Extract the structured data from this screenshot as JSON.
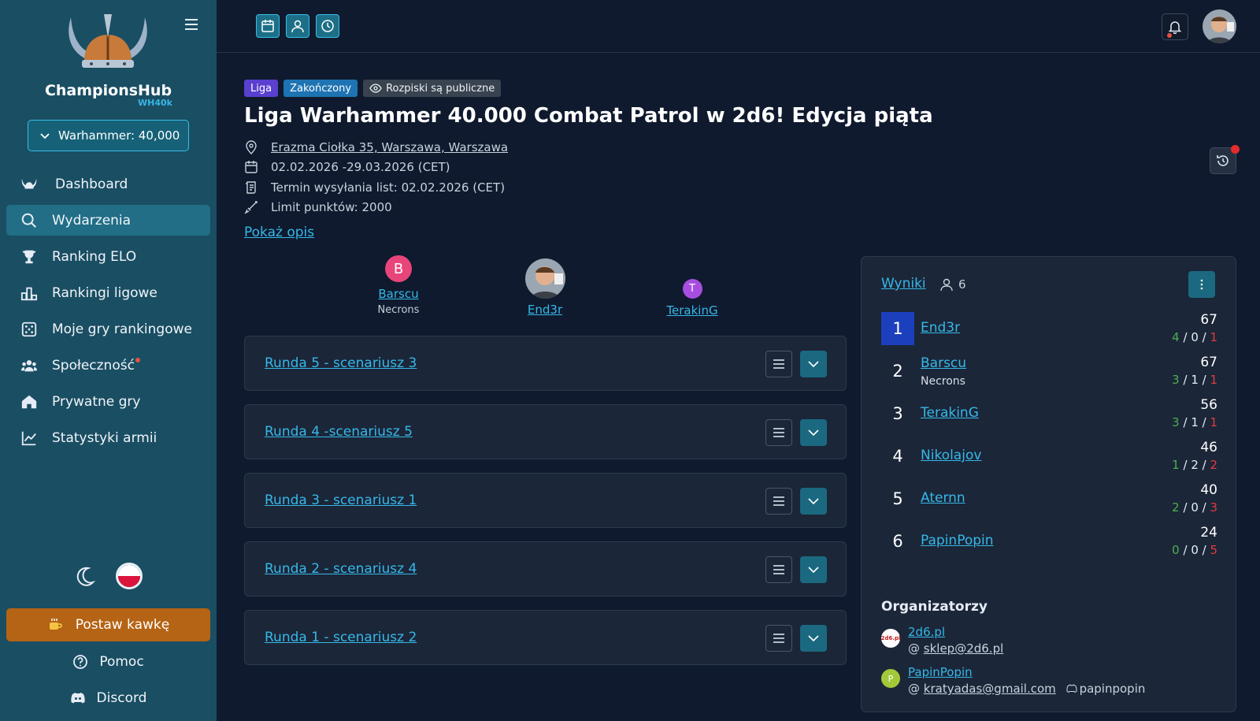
{
  "sidebar": {
    "brand": "ChampionsHub",
    "brand_sub": "WH40k",
    "game_select": "Warhammer: 40,000",
    "nav": [
      {
        "label": "Dashboard",
        "icon": "helmet-icon"
      },
      {
        "label": "Wydarzenia",
        "icon": "search-icon",
        "active": true
      },
      {
        "label": "Ranking ELO",
        "icon": "trophy-icon"
      },
      {
        "label": "Rankingi ligowe",
        "icon": "podium-icon"
      },
      {
        "label": "Moje gry rankingowe",
        "icon": "dice-icon"
      },
      {
        "label": "Społeczność",
        "icon": "community-icon",
        "notification": true
      },
      {
        "label": "Prywatne gry",
        "icon": "home-icon"
      },
      {
        "label": "Statystyki armii",
        "icon": "chart-line-icon"
      }
    ],
    "coffee": "Postaw kawkę",
    "help": "Pomoc",
    "discord": "Discord"
  },
  "event": {
    "badges": {
      "type": "Liga",
      "status": "Zakończony",
      "visibility": "Rozpiski są publiczne"
    },
    "title": "Liga Warhammer 40.000 Combat Patrol w 2d6! Edycja piąta",
    "address": "Erazma Ciołka 35, Warszawa, Warszawa",
    "dates": "02.02.2026 -29.03.2026 (CET)",
    "list_deadline": "Termin wysyłania list: 02.02.2026 (CET)",
    "points_limit": "Limit punktów: 2000",
    "show_description": "Pokaż opis"
  },
  "podium": {
    "second": {
      "initial": "B",
      "name": "Barscu",
      "faction": "Necrons",
      "color": "#e8457a"
    },
    "first": {
      "name": "End3r"
    },
    "third": {
      "initial": "T",
      "name": "TerakinG",
      "color": "#a74ee0"
    }
  },
  "rounds": [
    "Runda 5 - scenariusz 3",
    "Runda 4 -scenariusz 5",
    "Runda 3 - scenariusz 1",
    "Runda 2 - scenariusz 4",
    "Runda 1 - scenariusz 2"
  ],
  "results": {
    "title": "Wyniki",
    "count": "6",
    "rows": [
      {
        "rank": "1",
        "name": "End3r",
        "faction": "",
        "score": "67",
        "w": "4",
        "d": "0",
        "l": "1"
      },
      {
        "rank": "2",
        "name": "Barscu",
        "faction": "Necrons",
        "score": "67",
        "w": "3",
        "d": "1",
        "l": "1"
      },
      {
        "rank": "3",
        "name": "TerakinG",
        "faction": "",
        "score": "56",
        "w": "3",
        "d": "1",
        "l": "1"
      },
      {
        "rank": "4",
        "name": "Nikolajov",
        "faction": "",
        "score": "46",
        "w": "1",
        "d": "2",
        "l": "2"
      },
      {
        "rank": "5",
        "name": "Aternn",
        "faction": "",
        "score": "40",
        "w": "2",
        "d": "0",
        "l": "3"
      },
      {
        "rank": "6",
        "name": "PapinPopin",
        "faction": "",
        "score": "24",
        "w": "0",
        "d": "0",
        "l": "5"
      }
    ],
    "organizers_title": "Organizatorzy",
    "organizers": [
      {
        "name": "2d6.pl",
        "email": "sklep@2d6.pl",
        "discord": "",
        "avatar_text": "2d6.pl"
      },
      {
        "name": "PapinPopin",
        "email": "kratyadas@gmail.com",
        "discord": "papinpopin",
        "avatar_text": "P"
      }
    ]
  },
  "colors": {
    "accent": "#36b8e8",
    "sidebar": "#1a4e63",
    "bg": "#0f1a2e",
    "card": "#1b2638",
    "win": "#4caf50",
    "loss": "#e33b3b"
  }
}
